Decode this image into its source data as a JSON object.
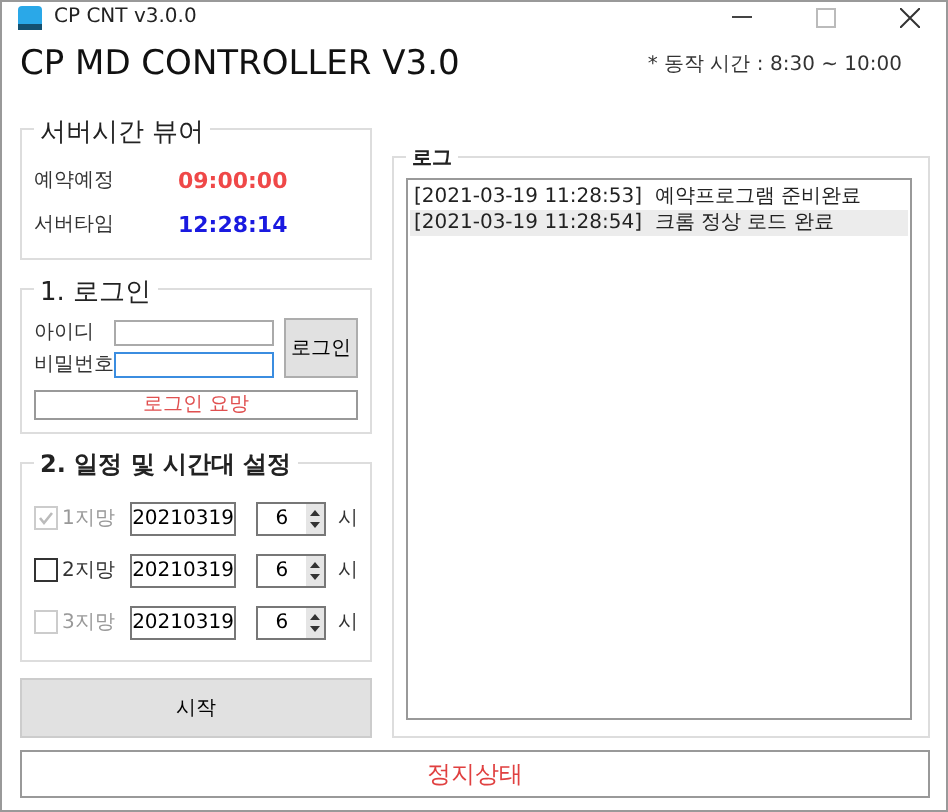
{
  "window": {
    "title": "CP CNT v3.0.0"
  },
  "heading": "CP MD CONTROLLER V3.0",
  "hours_note": "* 동작 시간 : 8:30 ~ 10:00",
  "server_viewer": {
    "title": "서버시간 뷰어",
    "rows": [
      {
        "label": "예약예정",
        "value": "09:00:00",
        "kind": "reserved"
      },
      {
        "label": "서버타임",
        "value": "12:28:14",
        "kind": "server"
      }
    ]
  },
  "login": {
    "title": "1. 로그인",
    "fields": [
      {
        "label": "아이디",
        "focused": false
      },
      {
        "label": "비밀번호",
        "focused": true
      }
    ],
    "button": "로그인",
    "status": "로그인 요망"
  },
  "schedule": {
    "title": "2. 일정 및 시간대 설정",
    "rows": [
      {
        "label": "1지망",
        "checked": true,
        "disabled": true,
        "date": "20210319",
        "hour": "6",
        "unit": "시"
      },
      {
        "label": "2지망",
        "checked": false,
        "disabled": false,
        "date": "20210319",
        "hour": "6",
        "unit": "시"
      },
      {
        "label": "3지망",
        "checked": false,
        "disabled": true,
        "date": "20210319",
        "hour": "6",
        "unit": "시"
      }
    ]
  },
  "start_button": "시작",
  "log": {
    "title": "로그",
    "entries": [
      {
        "time": "[2021-03-19 11:28:53]",
        "message": "예약프로그램 준비완료",
        "selected": false
      },
      {
        "time": "[2021-03-19 11:28:54]",
        "message": "크롬 정상 로드 완료",
        "selected": true
      }
    ]
  },
  "status_bar": "정지상태"
}
